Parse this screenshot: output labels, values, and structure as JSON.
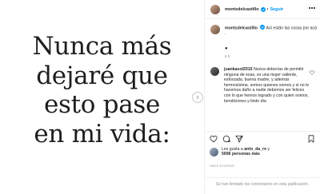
{
  "media": {
    "lines": [
      "Nunca más",
      "dejaré que",
      "esto pase",
      "en mi vida:"
    ]
  },
  "header": {
    "username": "montsdelcastillo",
    "separator": "•",
    "follow_label": "Seguir"
  },
  "caption": {
    "username": "montsdelcastillo",
    "text": "Así están las cosas por acá .",
    "bullet": "●",
    "time": "8 h"
  },
  "reply": {
    "username": "juankasol2015",
    "text": "Nunca deberías de permitir ninguna de esas, es una mujer valiente, esforzada, buena madre, y además hermosísima. somos quienes somos y si no le hacemos daño a nadie debemos ser felices con lo que hemos logrado y con quien somos, bendiciones y lindo día"
  },
  "likes": {
    "prefix": "Les gusta a",
    "user": "anto_da_re",
    "connector": "y",
    "count": "5696 personas más"
  },
  "posted_time": "HACE 8 HORAS",
  "comments_limited": "Se han limitado los comentarios en esta publicación.",
  "icons": {
    "verified": "verified-icon",
    "more": "more-icon",
    "next": "chevron-right-icon",
    "like": "heart-icon",
    "comment": "comment-icon",
    "share": "share-icon",
    "save": "bookmark-icon",
    "comment_like": "heart-icon"
  },
  "colors": {
    "accent": "#0095f6",
    "text": "#262626",
    "muted": "#8e8e8e"
  }
}
